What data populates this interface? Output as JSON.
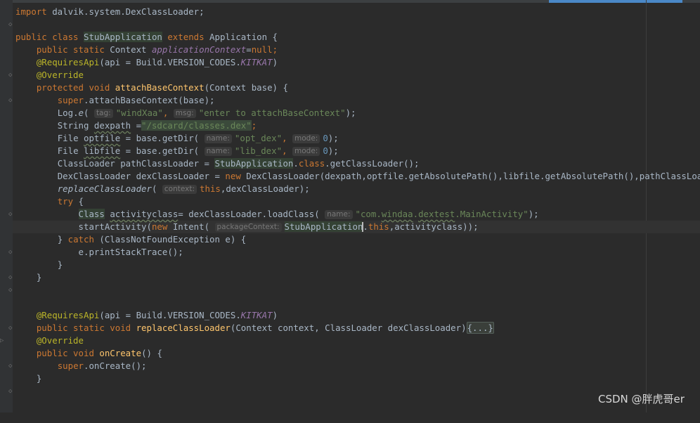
{
  "editor": {
    "watermark": "CSDN @胖虎哥er",
    "lines": {
      "l1": {
        "kw": "import",
        "rest": " dalvik.system.DexClassLoader;"
      },
      "l3": {
        "kw1": "public class ",
        "cls": "StubApplication",
        "kw2": " extends ",
        "rest": "Application {"
      },
      "l4": {
        "kw1": "public static ",
        "type": "Context ",
        "field": "applicationContext",
        "eq": "=",
        "kw2": "null",
        "semi": ";"
      },
      "l5": {
        "ann": "@RequiresApi",
        "open": "(api = Build.",
        "ver": "VERSION_CODES.",
        "const": "KITKAT",
        "close": ")"
      },
      "l6": {
        "ann": "@Override"
      },
      "l7": {
        "kw": "protected void ",
        "mth": "attachBaseContext",
        "rest": "(Context base) {"
      },
      "l8": {
        "kw": "super",
        "rest": ".attachBaseContext(base);"
      },
      "l9": {
        "pre": "Log.",
        "ital": "e",
        "open": "(",
        "hint1": "tag:",
        "str1": "\"windXaa\"",
        "comma": ",",
        "hint2": "msg:",
        "str2": "\"enter to attachBaseContext\"",
        "close": ");"
      },
      "l10": {
        "pre": "String ",
        "var": "dexpath",
        "eq": " =",
        "str": "\"/sdcard/classes.dex\"",
        "semi": ";"
      },
      "l11": {
        "pre": "File ",
        "var": "optfile",
        "mid": " = base.getDir(",
        "hint1": "name:",
        "str": "\"opt_dex\"",
        "comma": ",",
        "hint2": "mode:",
        "num": "0",
        "close": ");"
      },
      "l12": {
        "pre": "File ",
        "var": "libfile",
        "mid": " = base.getDir(",
        "hint1": "name:",
        "str": "\"lib_dex\"",
        "comma": ",",
        "hint2": "mode:",
        "num": "0",
        "close": ");"
      },
      "l13": {
        "pre": "ClassLoader pathClassLoader = ",
        "cls": "StubApplication",
        "dot": ".",
        "kw": "class",
        "rest": ".getClassLoader();"
      },
      "l14": {
        "pre": "DexClassLoader dexClassLoader = ",
        "kw": "new",
        "rest": " DexClassLoader(dexpath,optfile.getAbsolutePath(),libfile.getAbsolutePath(),pathClassLoader);"
      },
      "l15": {
        "ital": "replaceClassLoader",
        "open": "(",
        "hint": "context:",
        "kw": "this",
        "rest": ",dexClassLoader);"
      },
      "l16": {
        "kw": "try",
        "rest": " {"
      },
      "l17": {
        "cls": "Class",
        "sp": " ",
        "var": "activityclass",
        "mid": "= dexClassLoader.loadClass(",
        "hint": "name:",
        "str1": "\"com.",
        "str2": "windaa",
        "str3": ".",
        "str4": "dextest",
        "str5": ".MainActivity\"",
        "close": ");"
      },
      "l18": {
        "pre": "startActivity(",
        "kw": "new",
        "mid": " Intent(",
        "hint": "packageContext:",
        "cls": "StubApplication",
        "dot": ".",
        "kw2": "this",
        "rest": ",activityclass));"
      },
      "l19": {
        "pre": "} ",
        "kw": "catch",
        "rest": " (ClassNotFoundException e) {"
      },
      "l20": {
        "rest": "e.printStackTrace();"
      },
      "l21": {
        "rest": "}"
      },
      "l22": {
        "rest": "}"
      },
      "l25": {
        "ann": "@RequiresApi",
        "open": "(api = Build.",
        "ver": "VERSION_CODES.",
        "const": "KITKAT",
        "close": ")"
      },
      "l26": {
        "kw": "public static void ",
        "mth": "replaceClassLoader",
        "rest": "(Context context, ClassLoader dexClassLoader)",
        "folded": "{...}"
      },
      "l27": {
        "ann": "@Override"
      },
      "l28": {
        "kw": "public void ",
        "mth": "onCreate",
        "rest": "() {"
      },
      "l29": {
        "kw": "super",
        "rest": ".onCreate();"
      },
      "l30": {
        "rest": "}"
      }
    }
  }
}
